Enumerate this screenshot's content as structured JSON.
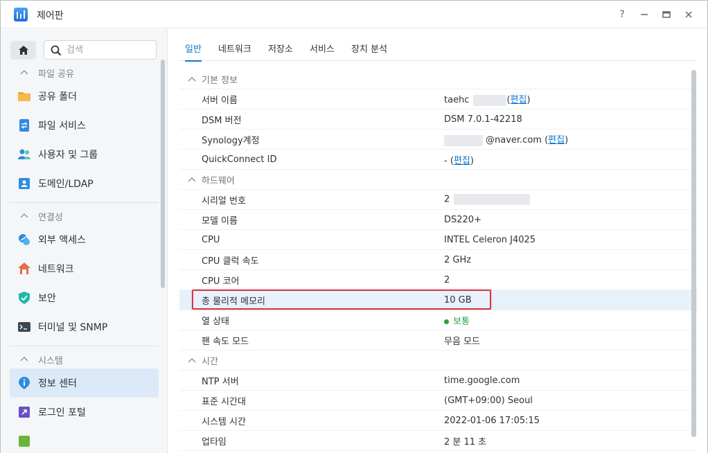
{
  "window": {
    "title": "제어판"
  },
  "window_controls": {
    "help": "?",
    "minimize": "—",
    "maximize": "▭",
    "close": "✕"
  },
  "sidebar": {
    "search_placeholder": "검색",
    "sections": [
      {
        "label": "파일 공유",
        "items": [
          {
            "label": "공유 폴더",
            "icon": "shared-folder-icon"
          },
          {
            "label": "파일 서비스",
            "icon": "file-services-icon"
          },
          {
            "label": "사용자 및 그룹",
            "icon": "users-icon"
          },
          {
            "label": "도메인/LDAP",
            "icon": "domain-icon"
          }
        ]
      },
      {
        "label": "연결성",
        "items": [
          {
            "label": "외부 액세스",
            "icon": "external-access-icon"
          },
          {
            "label": "네트워크",
            "icon": "network-icon"
          },
          {
            "label": "보안",
            "icon": "security-shield-icon"
          },
          {
            "label": "터미널 및 SNMP",
            "icon": "terminal-icon"
          }
        ]
      },
      {
        "label": "시스템",
        "items": [
          {
            "label": "정보 센터",
            "icon": "info-center-icon",
            "active": true
          },
          {
            "label": "로그인 포털",
            "icon": "login-portal-icon"
          }
        ]
      }
    ]
  },
  "tabs": [
    "일반",
    "네트워크",
    "저장소",
    "서비스",
    "장치 분석"
  ],
  "general": {
    "basic": {
      "title": "기본 정보",
      "server_name_label": "서버 이름",
      "server_name_value": "taehc",
      "dsm_version_label": "DSM 버전",
      "dsm_version_value": "DSM 7.0.1-42218",
      "synology_account_label": "Synology계정",
      "synology_account_value": "@naver.com",
      "quickconnect_label": "QuickConnect ID",
      "quickconnect_value": "-",
      "edit_label": "편집"
    },
    "hardware": {
      "title": "하드웨어",
      "serial_label": "시리얼 번호",
      "serial_value": "2",
      "model_label": "모델 이름",
      "model_value": "DS220+",
      "cpu_label": "CPU",
      "cpu_value": "INTEL Celeron J4025",
      "clock_label": "CPU 클럭 속도",
      "clock_value": "2 GHz",
      "cores_label": "CPU 코어",
      "cores_value": "2",
      "memory_label": "총 물리적 메모리",
      "memory_value": "10 GB",
      "thermal_label": "열 상태",
      "thermal_value": "보통",
      "fan_label": "팬 속도 모드",
      "fan_value": "무음 모드"
    },
    "time": {
      "title": "시간",
      "ntp_label": "NTP 서버",
      "ntp_value": "time.google.com",
      "tz_label": "표준 시간대",
      "tz_value": "(GMT+09:00) Seoul",
      "systime_label": "시스템 시간",
      "systime_value": "2022-01-06 17:05:15",
      "uptime_label": "업타임",
      "uptime_value": "2 분 11 초"
    }
  },
  "colors": {
    "accent": "#0b76d4",
    "highlight": "#d9363e",
    "ok": "#24a148"
  }
}
